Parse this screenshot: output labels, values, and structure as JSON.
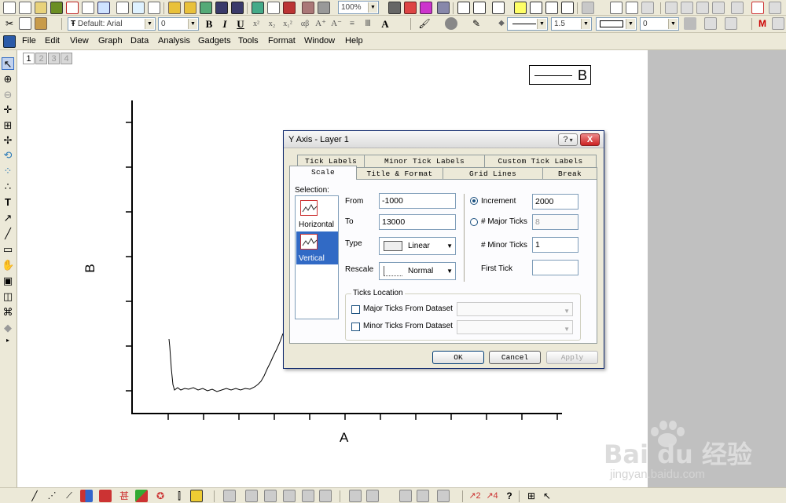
{
  "toolbar": {
    "zoom": "100%",
    "font_name": "Default: Arial",
    "font_size": "0",
    "line_width": "1.5",
    "fill_value": "0"
  },
  "menu": [
    "File",
    "Edit",
    "View",
    "Graph",
    "Data",
    "Analysis",
    "Gadgets",
    "Tools",
    "Format",
    "Window",
    "Help"
  ],
  "layer_tabs": [
    "1",
    "2",
    "3",
    "4"
  ],
  "graph": {
    "legend_label": "B",
    "x_axis_label": "A",
    "y_axis_label": "B"
  },
  "dialog": {
    "title": "Y Axis - Layer 1",
    "help_btn": "?",
    "close_btn": "X",
    "tabs_back": [
      "Tick Labels",
      "Minor Tick Labels",
      "Custom Tick Labels"
    ],
    "tabs_front": [
      "Scale",
      "Title & Format",
      "Grid Lines",
      "Break"
    ],
    "active_tab": "Scale",
    "selection_label": "Selection:",
    "selection_items": [
      "Horizontal",
      "Vertical"
    ],
    "selected_item": "Vertical",
    "from_label": "From",
    "from_value": "-1000",
    "to_label": "To",
    "to_value": "13000",
    "type_label": "Type",
    "type_value": "Linear",
    "rescale_label": "Rescale",
    "rescale_value": "Normal",
    "increment_label": "Increment",
    "increment_value": "2000",
    "major_ticks_label": "# Major Ticks",
    "major_ticks_value": "8",
    "minor_ticks_label": "# Minor Ticks",
    "minor_ticks_value": "1",
    "first_tick_label": "First Tick",
    "first_tick_value": "",
    "ticks_location_label": "Ticks Location",
    "major_from_dataset": "Major Ticks From Dataset",
    "minor_from_dataset": "Minor Ticks From Dataset",
    "ok": "OK",
    "cancel": "Cancel",
    "apply": "Apply"
  },
  "watermark": {
    "brand": "Bai du 经验",
    "url": "jingyan.baidu.com"
  }
}
